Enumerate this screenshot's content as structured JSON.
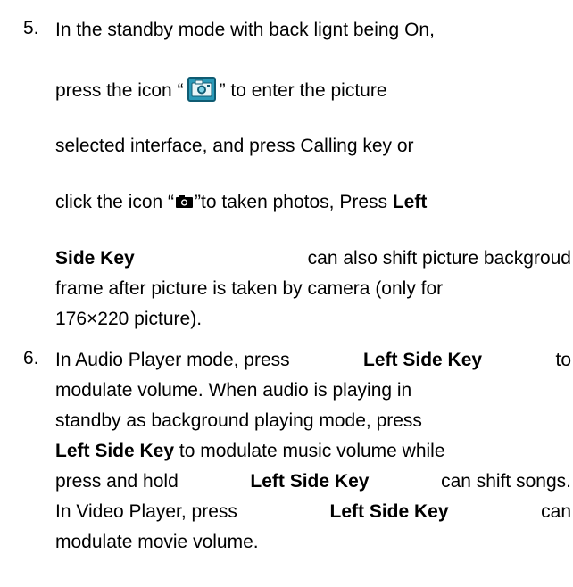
{
  "item5": {
    "number": "5.",
    "line1": "In the standby mode with back lignt being On,",
    "line2_a": "press the icon “",
    "line2_b": "” to enter the picture",
    "line3": "selected interface, and press Calling key or",
    "line4_a": "click the icon “",
    "line4_b": "”to taken photos, Press",
    "line4_bold": "Left",
    "line5_bold": "Side Key",
    "line5_rest": "can also shift picture backgroud",
    "line6": "frame after picture is taken by camera (only for",
    "line7": "176×220 picture).",
    "icon_camera_app": "camera-app-icon",
    "icon_camera": "camera-icon"
  },
  "item6": {
    "number": "6.",
    "line1_a": "In Audio Player mode, press",
    "line1_bold": "Left Side Key",
    "line1_b": "to",
    "line2": "modulate volume. When audio is playing in",
    "line3": "standby as background playing mode, press",
    "line4_bold": "Left Side Key",
    "line4_rest": "to modulate music volume while",
    "line5_a": "press and hold",
    "line5_bold": "Left Side Key",
    "line5_b": "can shift songs.",
    "line6_a": "In Video Player, press",
    "line6_bold": "Left Side Key",
    "line6_b": "can",
    "line7": "modulate movie volume."
  },
  "colors": {
    "text": "#000000",
    "icon_bg": "#2b9ab8",
    "icon_border": "#0f5b72"
  }
}
